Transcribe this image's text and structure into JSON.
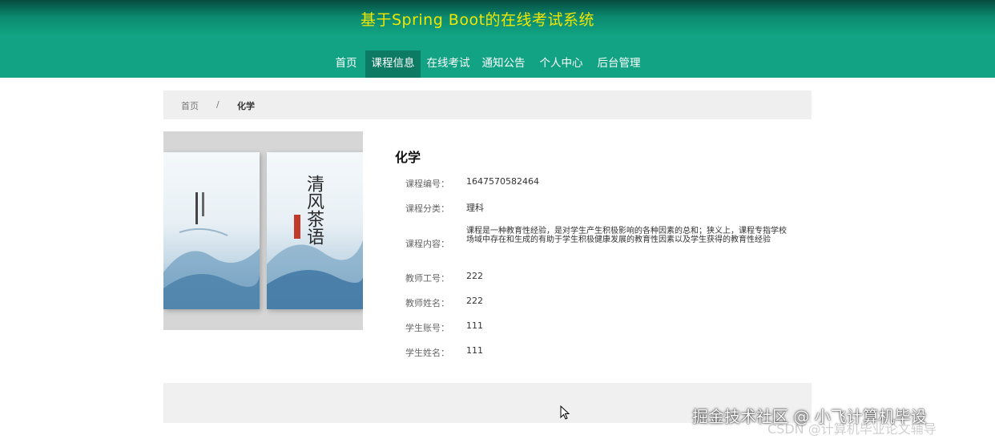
{
  "header": {
    "site_title": "基于Spring Boot的在线考试系统",
    "nav": [
      {
        "label": "首页",
        "active": false
      },
      {
        "label": "课程信息",
        "active": true
      },
      {
        "label": "在线考试",
        "active": false
      },
      {
        "label": "通知公告",
        "active": false
      },
      {
        "label": "个人中心",
        "active": false
      },
      {
        "label": "后台管理",
        "active": false
      }
    ]
  },
  "breadcrumb": {
    "home": "首页",
    "separator": "/",
    "current": "化学"
  },
  "cover": {
    "book_title": "清风茶语"
  },
  "detail": {
    "title": "化学",
    "fields": [
      {
        "label": "课程编号：",
        "value": "1647570582464"
      },
      {
        "label": "课程分类：",
        "value": "理科"
      },
      {
        "label": "课程内容：",
        "value": "课程是一种教育性经验，是对学生产生积极影响的各种因素的总和；狭义上，课程专指学校场域中存在和生成的有助于学生积极健康发展的教育性因素以及学生获得的教育性经验"
      },
      {
        "label": "教师工号：",
        "value": "222"
      },
      {
        "label": "教师姓名：",
        "value": "222"
      },
      {
        "label": "学生账号：",
        "value": "111"
      },
      {
        "label": "学生姓名：",
        "value": "111"
      }
    ]
  },
  "watermark": {
    "main": "掘金技术社区 @ 小飞计算机毕设",
    "sub": "CSDN @计算机毕业论文辅导"
  },
  "colors": {
    "header_green": "#12a384",
    "title_yellow": "#f2e600",
    "nav_active": "#0d7a64"
  }
}
